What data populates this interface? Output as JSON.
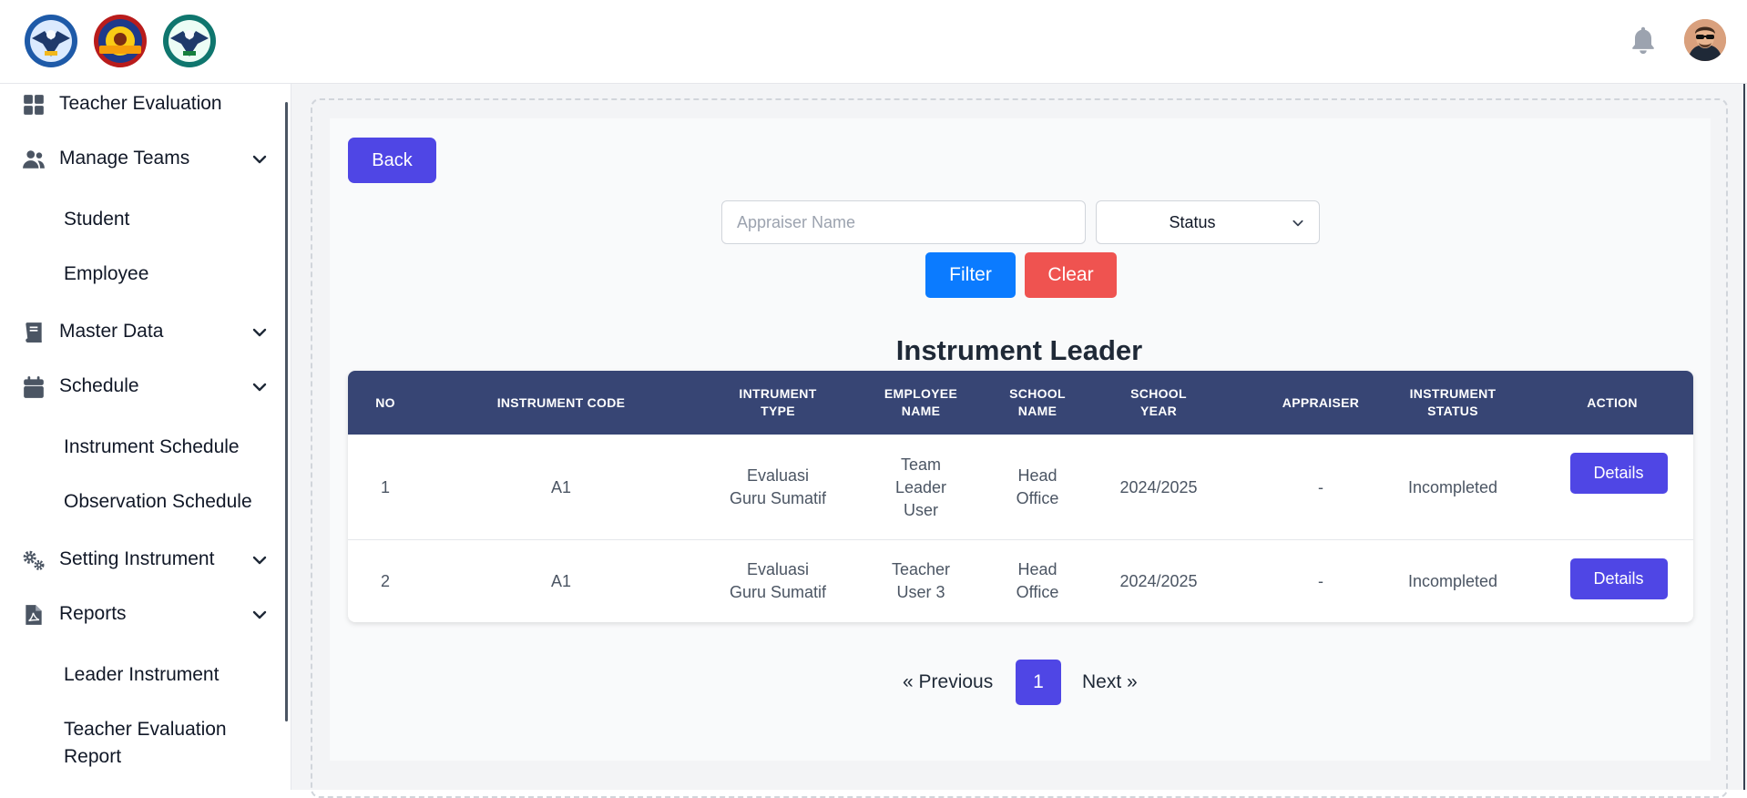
{
  "header": {
    "logos": [
      "school-logo-1",
      "school-logo-2",
      "school-logo-3"
    ],
    "notification_icon": "bell-icon",
    "avatar_icon": "user-avatar"
  },
  "sidebar": {
    "items": [
      {
        "label": "Teacher Evaluation",
        "icon": "dashboard-grid-icon",
        "expandable": false
      },
      {
        "label": "Manage Teams",
        "icon": "users-icon",
        "expandable": true,
        "children": [
          "Student",
          "Employee"
        ]
      },
      {
        "label": "Master Data",
        "icon": "book-icon",
        "expandable": true
      },
      {
        "label": "Schedule",
        "icon": "calendar-icon",
        "expandable": true,
        "children": [
          "Instrument Schedule",
          "Observation Schedule"
        ]
      },
      {
        "label": "Setting Instrument",
        "icon": "gears-icon",
        "expandable": true
      },
      {
        "label": "Reports",
        "icon": "pdf-file-icon",
        "expandable": true,
        "children": [
          "Leader Instrument",
          "Teacher Evaluation Report"
        ]
      }
    ]
  },
  "main": {
    "back_label": "Back",
    "filters": {
      "appraiser_placeholder": "Appraiser Name",
      "appraiser_value": "",
      "status_value": "Status",
      "filter_label": "Filter",
      "clear_label": "Clear"
    },
    "table": {
      "title": "Instrument Leader",
      "headers": [
        "NO",
        "INSTRUMENT CODE",
        "INTRUMENT TYPE",
        "EMPLOYEE NAME",
        "SCHOOL NAME",
        "SCHOOL YEAR",
        "APPRAISER",
        "INSTRUMENT STATUS",
        "ACTION"
      ],
      "rows": [
        {
          "no": "1",
          "code": "A1",
          "type": "Evaluasi Guru Sumatif",
          "employee": "Team Leader User",
          "school": "Head Office",
          "year": "2024/2025",
          "appraiser": "-",
          "status": "Incompleted",
          "action": "Details"
        },
        {
          "no": "2",
          "code": "A1",
          "type": "Evaluasi Guru Sumatif",
          "employee": "Teacher User 3",
          "school": "Head Office",
          "year": "2024/2025",
          "appraiser": "-",
          "status": "Incompleted",
          "action": "Details"
        }
      ]
    },
    "pagination": {
      "previous_label": "« Previous",
      "current_page": "1",
      "next_label": "Next »"
    }
  },
  "colors": {
    "primary": "#4f46e5",
    "filter": "#0b7bff",
    "clear": "#ef5350",
    "table_header": "#374574"
  }
}
